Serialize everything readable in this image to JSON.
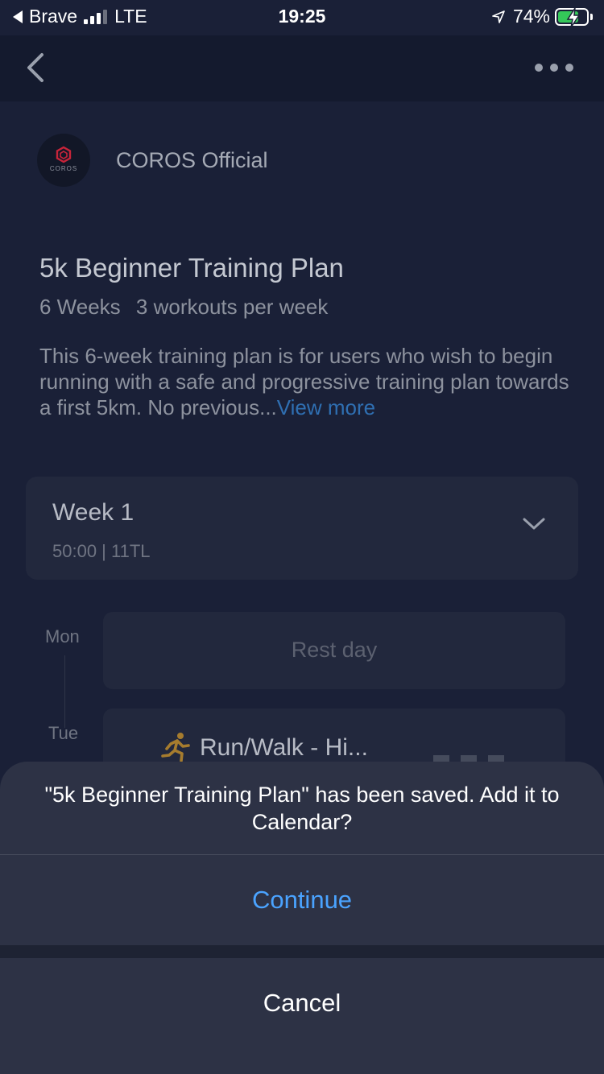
{
  "status_bar": {
    "back_app": "Brave",
    "network": "LTE",
    "time": "19:25",
    "battery_pct": "74%",
    "battery_level": 0.74,
    "signal_bars_filled": 3,
    "signal_bars_total": 4
  },
  "nav": {
    "back_icon": "chevron-left-icon",
    "more_icon": "ellipsis-icon"
  },
  "author": {
    "name": "COROS Official",
    "logo_text": "COROS"
  },
  "plan": {
    "title": "5k Beginner Training Plan",
    "duration": "6 Weeks",
    "frequency": "3 workouts per week",
    "description": "This 6-week training plan is for users who wish to begin running with a safe and progressive training plan towards a first 5km. No previous...",
    "view_more": "View more"
  },
  "week": {
    "title": "Week 1",
    "summary": "50:00 | 11TL"
  },
  "days": [
    {
      "day": "Mon",
      "label": "Rest day"
    },
    {
      "day": "Tue",
      "label": "Run/Walk - Hi..."
    }
  ],
  "action_sheet": {
    "message": "\"5k Beginner Training Plan\" has been saved. Add it to Calendar?",
    "continue_label": "Continue",
    "cancel_label": "Cancel"
  },
  "colors": {
    "accent": "#4aa3ff",
    "link": "#2f6fb2",
    "battery_green": "#34c759",
    "brand_red": "#c8243a",
    "runner_gold": "#a67c2e"
  }
}
